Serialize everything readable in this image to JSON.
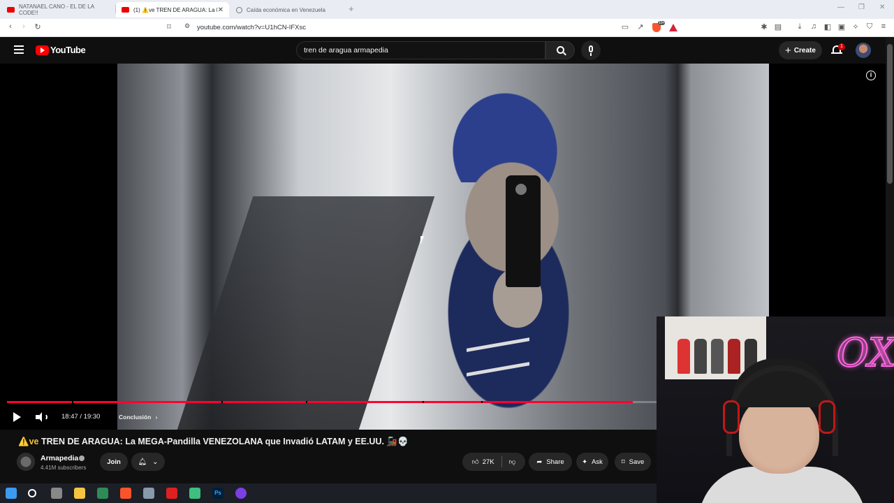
{
  "browser": {
    "tabs": [
      {
        "label": "NATANAEL CANO - EL DE LA CODE!!",
        "active": false
      },
      {
        "label": "(1) ⚠️ve TREN DE ARAGUA: La M",
        "active": true
      },
      {
        "label": "Caída económica en Venezuela",
        "active": false
      }
    ],
    "url": "youtube.com/watch?v=U1hCN-IFXsc",
    "brave_badge": "10+"
  },
  "youtube": {
    "logo_text": "YouTube",
    "search_value": "tren de aragua armapedia",
    "create_label": "Create",
    "notification_count": "1"
  },
  "player": {
    "current_time": "18:47",
    "duration": "19:30",
    "time_display": "18:47 / 19:30",
    "chapter": "Conclusión",
    "progress_fraction": 0.963,
    "chapter_marks": [
      0.1,
      0.33,
      0.46,
      0.64,
      0.73
    ],
    "info_icon": "i"
  },
  "video": {
    "title_prefix": "⚠️ve",
    "title": "TREN DE ARAGUA: La MEGA-Pandilla VENEZOLANA que Invadió LATAM y EE.UU. 🚂💀",
    "channel": "Armapedia",
    "subscribers": "4.41M subscribers",
    "join_label": "Join",
    "likes": "27K",
    "share_label": "Share",
    "ask_label": "Ask",
    "save_label": "Save"
  },
  "webcam": {
    "neon_sign": "OX"
  },
  "colors": {
    "yt_red": "#ff0000",
    "progress": "#ff0033",
    "background": "#0f0f0f"
  }
}
